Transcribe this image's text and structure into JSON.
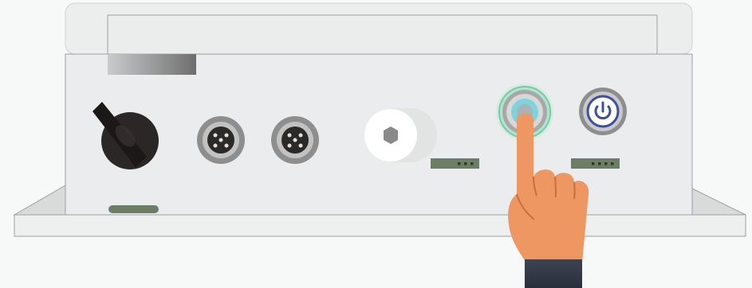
{
  "device": {
    "name": "control-box",
    "colors": {
      "background": "#f7f9f9",
      "body": "#ebeced",
      "outline": "#9aa0a2",
      "dark_label": "#6e7e66",
      "label_dot": "#2d3a2a",
      "knob": "#2b2726",
      "connector_ring": "#8e8e8e",
      "active_glow": "#6cd0a6",
      "active_button": "#7fd3df",
      "power_button": "#3e4fa0",
      "hand_skin": "#ee9763",
      "sleeve": "#343b49"
    }
  },
  "indicators": {
    "green_button_dots": 3,
    "power_button_dots": 4
  }
}
